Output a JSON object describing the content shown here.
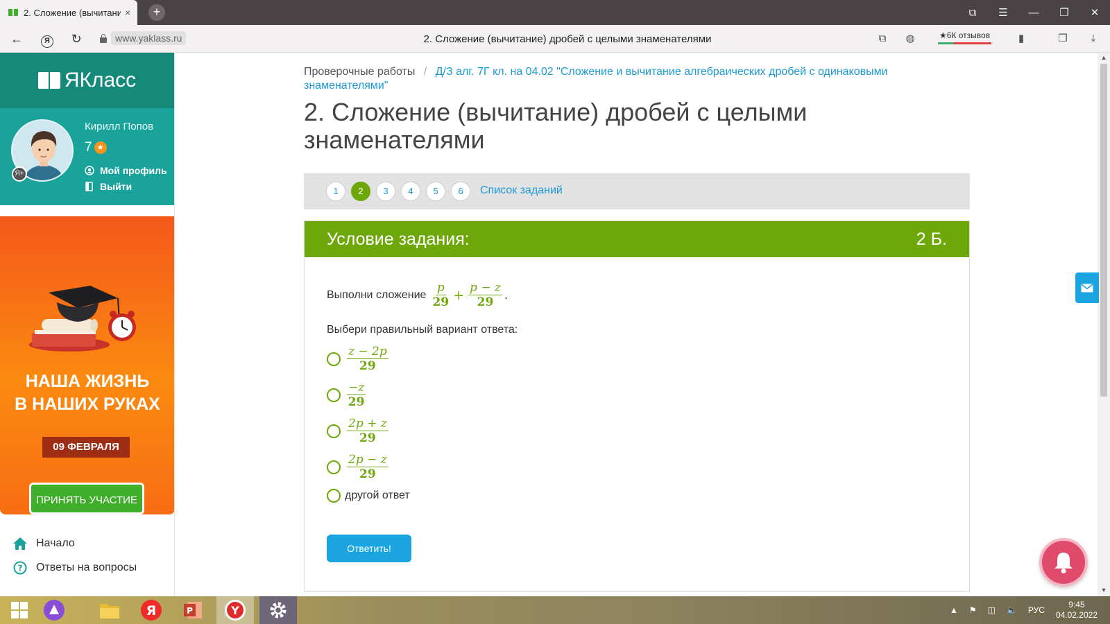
{
  "browser": {
    "tab_title": "2. Сложение (вычитани",
    "tab_close": "×",
    "newtab": "+",
    "url_domain": "www.yaklass.ru",
    "page_title": "2. Сложение (вычитание) дробей с целыми знаменателями",
    "reviews": "★6К отзывов",
    "ya_btn": "Я",
    "back": "←",
    "reload": "↻",
    "window_controls": [
      "⧉",
      "☰",
      "—",
      "❐",
      "✕"
    ]
  },
  "sidebar": {
    "logo_text": "ЯКласс",
    "user_name": "Кирилл Попов",
    "points": "7",
    "star": "★",
    "avatar_badge": "Я+",
    "profile_link": "Мой профиль",
    "logout_link": "Выйти",
    "promo": {
      "title_line1": "НАША ЖИЗНЬ",
      "title_line2": "В НАШИХ РУКАХ",
      "date": "09 ФЕВРАЛЯ",
      "cta": "ПРИНЯТЬ УЧАСТИЕ"
    },
    "nav": [
      {
        "label": "Начало",
        "icon": "home-icon"
      },
      {
        "label": "Ответы на вопросы",
        "icon": "question-icon"
      }
    ]
  },
  "main": {
    "breadcrumb_root": "Проверочные работы",
    "breadcrumb_sep": "/",
    "breadcrumb_link": "Д/З алг. 7Г кл. на 04.02 \"Сложение и вычитание алгебраических дробей с одинаковыми знаменателями\"",
    "title": "2. Сложение (вычитание) дробей с целыми знаменателями",
    "pager": [
      "1",
      "2",
      "3",
      "4",
      "5",
      "6"
    ],
    "pager_active": 2,
    "task_list_link": "Список заданий",
    "task_header": "Условие задания:",
    "task_points": "2 Б.",
    "prompt": "Выполни сложение",
    "prompt_math": {
      "frac1_num": "p",
      "frac1_den": "29",
      "plus": "+",
      "frac2_num": "p − z",
      "frac2_den": "29",
      "end": "."
    },
    "choose_label": "Выбери правильный вариант ответа:",
    "options": [
      {
        "num": "z − 2p",
        "den": "29"
      },
      {
        "num": "−z",
        "den": "29"
      },
      {
        "num": "2p + z",
        "den": "29"
      },
      {
        "num": "2p − z",
        "den": "29"
      },
      {
        "text": "другой ответ"
      }
    ],
    "answer_button": "Ответить!"
  },
  "taskbar": {
    "language": "РУС",
    "time": "9:45",
    "date": "04.02.2022",
    "ya_label": "Я",
    "y_label": "Y"
  },
  "colors": {
    "brand_teal": "#15897a",
    "task_green": "#6ea70a",
    "link_blue": "#1a9ad6",
    "promo_orange": "#f86d13",
    "button_blue": "#1aa4e0"
  }
}
